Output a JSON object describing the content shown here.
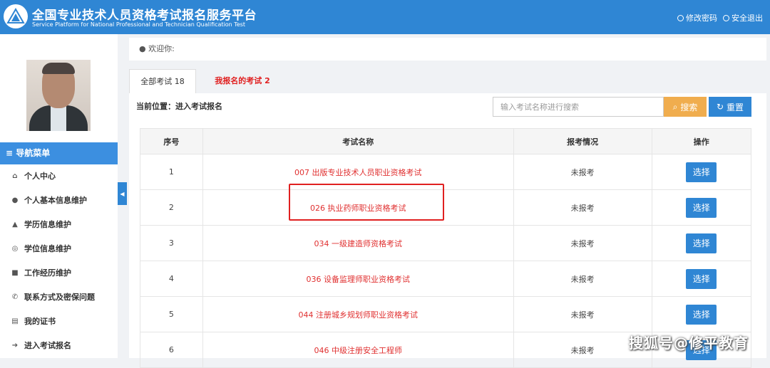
{
  "header": {
    "title": "全国专业技术人员资格考试报名服务平台",
    "subtitle": "Service Platform for National Professional and Technician Qualification Test",
    "actions": [
      {
        "label": "修改密码",
        "icon": "gear-icon"
      },
      {
        "label": "安全退出",
        "icon": "power-icon"
      }
    ]
  },
  "sidebar": {
    "nav_title": "导航菜单",
    "items": [
      {
        "label": "个人中心",
        "icon": "home-icon"
      },
      {
        "label": "个人基本信息维护",
        "icon": "user-icon"
      },
      {
        "label": "学历信息维护",
        "icon": "graduation-cap-icon"
      },
      {
        "label": "学位信息维护",
        "icon": "medal-icon"
      },
      {
        "label": "工作经历维护",
        "icon": "briefcase-icon"
      },
      {
        "label": "联系方式及密保问题",
        "icon": "phone-icon"
      },
      {
        "label": "我的证书",
        "icon": "certificate-icon"
      },
      {
        "label": "进入考试报名",
        "icon": "signin-icon"
      }
    ]
  },
  "welcome": {
    "label": "欢迎你:"
  },
  "tabs": [
    {
      "label": "全部考试 18"
    },
    {
      "label": "我报名的考试 2"
    }
  ],
  "breadcrumb": "当前位置：进入考试报名",
  "search": {
    "placeholder": "输入考试名称进行搜索",
    "button": "搜索",
    "reset": "重置"
  },
  "table": {
    "headers": [
      "序号",
      "考试名称",
      "报考情况",
      "操作"
    ],
    "rows": [
      {
        "idx": "1",
        "name": "007 出版专业技术人员职业资格考试",
        "status": "未报考",
        "action": "选择"
      },
      {
        "idx": "2",
        "name": "026 执业药师职业资格考试",
        "status": "未报考",
        "action": "选择"
      },
      {
        "idx": "3",
        "name": "034 一级建造师资格考试",
        "status": "未报考",
        "action": "选择"
      },
      {
        "idx": "4",
        "name": "036 设备监理师职业资格考试",
        "status": "未报考",
        "action": "选择"
      },
      {
        "idx": "5",
        "name": "044 注册城乡规划师职业资格考试",
        "status": "未报考",
        "action": "选择"
      },
      {
        "idx": "6",
        "name": "046 中级注册安全工程师",
        "status": "未报考",
        "action": "选择"
      }
    ]
  },
  "watermark": "搜狐号@修平教育",
  "colors": {
    "primary": "#2f86d4",
    "warning": "#f0ad4e",
    "danger": "#e02020"
  }
}
